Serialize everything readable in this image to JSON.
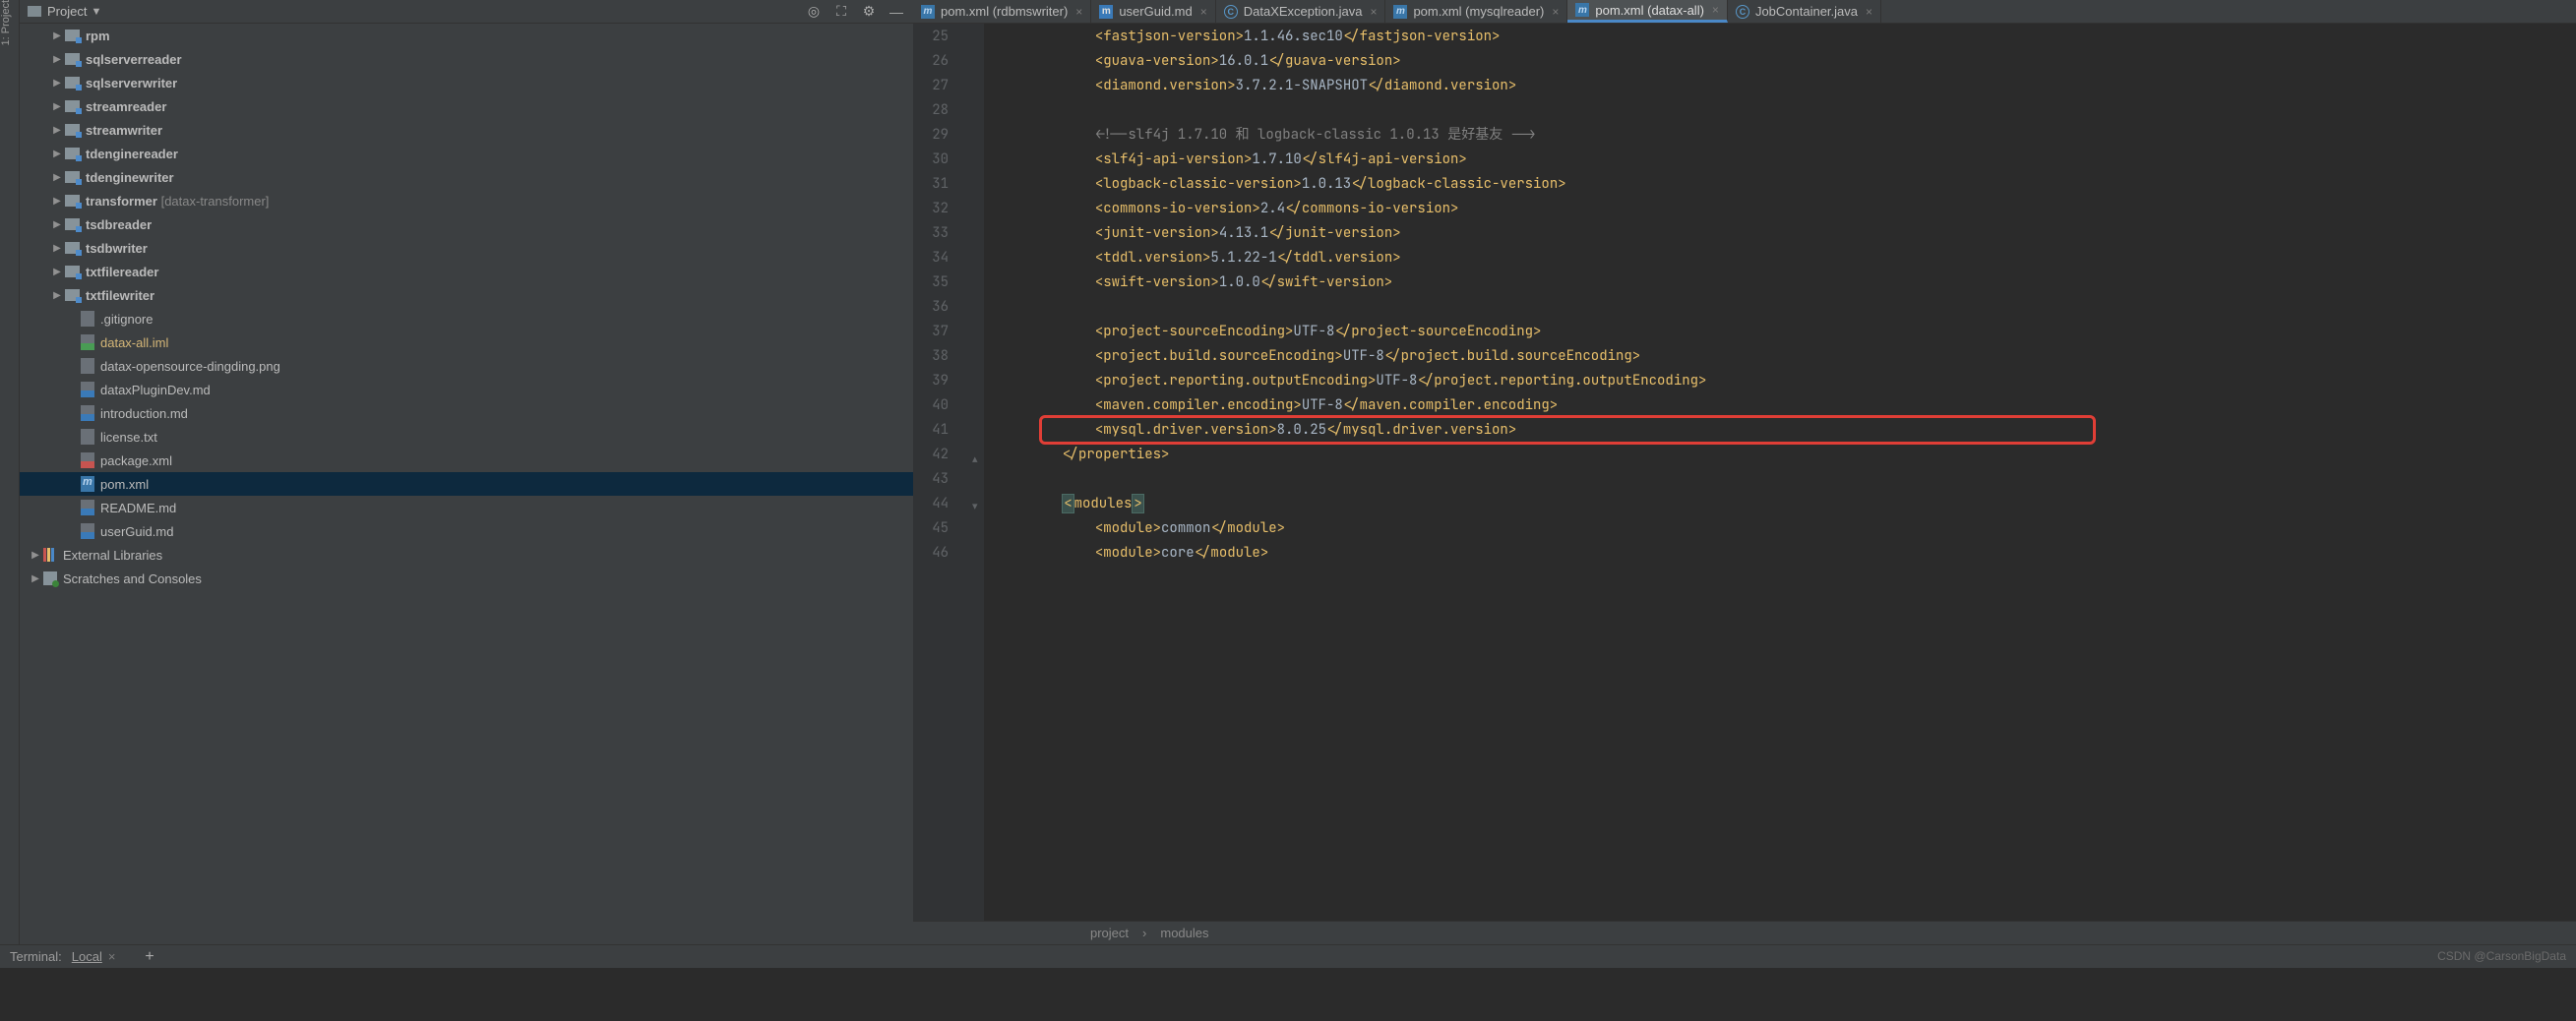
{
  "leftRail": {
    "label": "1: Project"
  },
  "projectToolbar": {
    "label": "Project"
  },
  "tree": {
    "folders": [
      "rpm",
      "sqlserverreader",
      "sqlserverwriter",
      "streamreader",
      "streamwriter",
      "tdenginereader",
      "tdenginewriter",
      "transformer",
      "tsdbreader",
      "tsdbwriter",
      "txtfilereader",
      "txtfilewriter"
    ],
    "transformerExtra": " [datax-transformer]",
    "files": [
      {
        "name": ".gitignore",
        "cls": ""
      },
      {
        "name": "datax-all.iml",
        "cls": "iml",
        "highlight": true
      },
      {
        "name": "datax-opensource-dingding.png",
        "cls": ""
      },
      {
        "name": "dataxPluginDev.md",
        "cls": "md"
      },
      {
        "name": "introduction.md",
        "cls": "md"
      },
      {
        "name": "license.txt",
        "cls": ""
      },
      {
        "name": "package.xml",
        "cls": "xml"
      },
      {
        "name": "pom.xml",
        "cls": "maven",
        "selected": true
      },
      {
        "name": "README.md",
        "cls": "md"
      },
      {
        "name": "userGuid.md",
        "cls": "md"
      }
    ],
    "external": "External Libraries",
    "scratches": "Scratches and Consoles"
  },
  "tabs": [
    {
      "label": "pom.xml (rdbmswriter)",
      "icon": "maven"
    },
    {
      "label": "userGuid.md",
      "icon": "md"
    },
    {
      "label": "DataXException.java",
      "icon": "java"
    },
    {
      "label": "pom.xml (mysqlreader)",
      "icon": "maven"
    },
    {
      "label": "pom.xml (datax-all)",
      "icon": "maven",
      "active": true
    },
    {
      "label": "JobContainer.java",
      "icon": "java"
    }
  ],
  "gutter": {
    "start": 25,
    "end": 46
  },
  "code": {
    "lines": [
      {
        "indent": 3,
        "tag": "fastjson-version",
        "value": "1.1.46.sec10"
      },
      {
        "indent": 3,
        "tag": "guava-version",
        "value": "16.0.1"
      },
      {
        "indent": 3,
        "tag": "diamond.version",
        "value": "3.7.2.1-SNAPSHOT"
      },
      {
        "blank": true
      },
      {
        "indent": 3,
        "comment": "<!--slf4j 1.7.10 和 logback-classic 1.0.13 是好基友 -->"
      },
      {
        "indent": 3,
        "tag": "slf4j-api-version",
        "value": "1.7.10"
      },
      {
        "indent": 3,
        "tag": "logback-classic-version",
        "value": "1.0.13"
      },
      {
        "indent": 3,
        "tag": "commons-io-version",
        "value": "2.4"
      },
      {
        "indent": 3,
        "tag": "junit-version",
        "value": "4.13.1"
      },
      {
        "indent": 3,
        "tag": "tddl.version",
        "value": "5.1.22-1"
      },
      {
        "indent": 3,
        "tag": "swift-version",
        "value": "1.0.0"
      },
      {
        "blank": true
      },
      {
        "indent": 3,
        "tag": "project-sourceEncoding",
        "value": "UTF-8"
      },
      {
        "indent": 3,
        "tag": "project.build.sourceEncoding",
        "value": "UTF-8"
      },
      {
        "indent": 3,
        "tag": "project.reporting.outputEncoding",
        "value": "UTF-8"
      },
      {
        "indent": 3,
        "tag": "maven.compiler.encoding",
        "value": "UTF-8"
      },
      {
        "indent": 3,
        "tag": "mysql.driver.version",
        "value": "8.0.25"
      },
      {
        "indent": 2,
        "closeTag": "properties"
      },
      {
        "blank": true
      },
      {
        "indent": 2,
        "openTagHl": "modules"
      },
      {
        "indent": 3,
        "tag": "module",
        "value": "common"
      },
      {
        "indent": 3,
        "tag": "module",
        "value": "core"
      }
    ]
  },
  "breadcrumb": {
    "p1": "project",
    "p2": "modules"
  },
  "bottomBar": {
    "terminal": "Terminal:",
    "local": "Local"
  },
  "watermark": "CSDN @CarsonBigData"
}
